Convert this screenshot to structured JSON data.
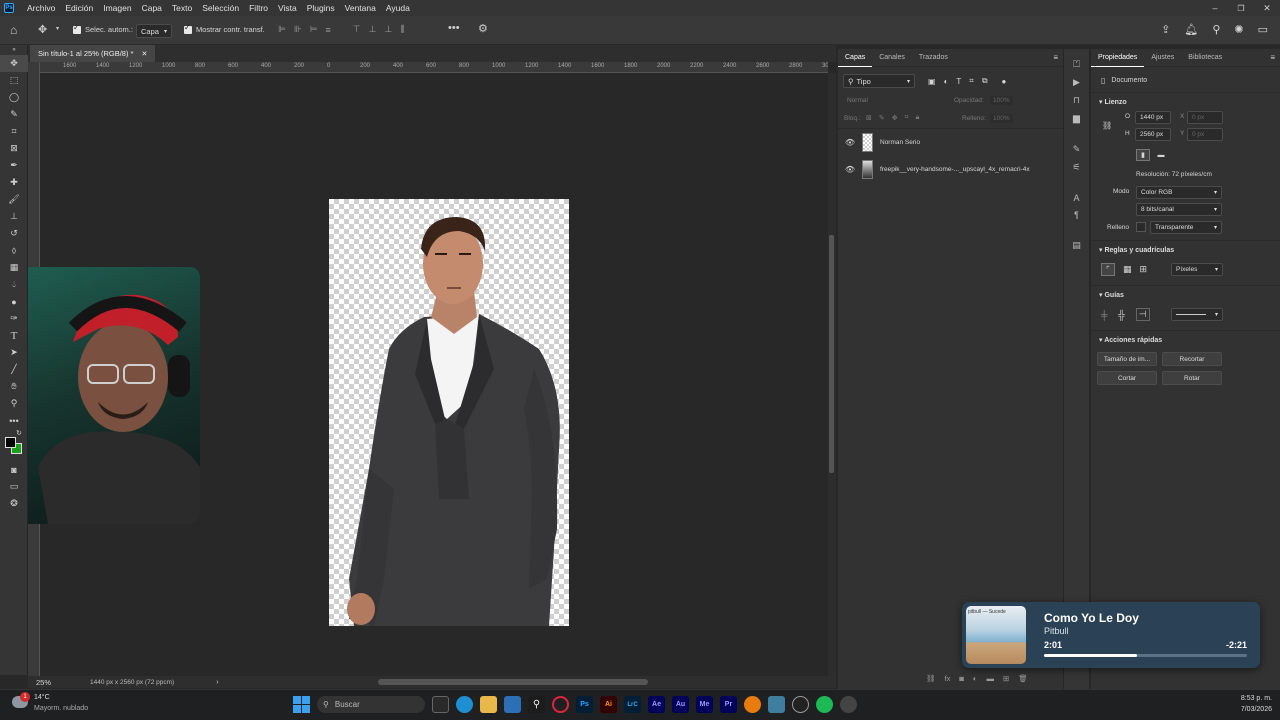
{
  "menu": [
    "Archivo",
    "Edición",
    "Imagen",
    "Capa",
    "Texto",
    "Selección",
    "Filtro",
    "Vista",
    "Plugins",
    "Ventana",
    "Ayuda"
  ],
  "options_bar": {
    "auto_select_label": "Selec. autom.:",
    "auto_select_value": "Capa",
    "show_transform_label": "Mostrar contr. transf."
  },
  "document": {
    "tab_title": "Sin título-1 al 25% (RGB/8) *",
    "zoom": "25%",
    "status": "1440 px x 2560 px (72 ppcm)"
  },
  "ruler_ticks": [
    "1600",
    "1400",
    "1200",
    "1000",
    "800",
    "600",
    "400",
    "200",
    "0",
    "200",
    "400",
    "600",
    "800",
    "1000",
    "1200",
    "1400",
    "1600",
    "1800",
    "2000",
    "2200",
    "2400",
    "2600",
    "2800",
    "3000"
  ],
  "layers_panel": {
    "tabs": [
      "Capas",
      "Canales",
      "Trazados"
    ],
    "active_tab": "Capas",
    "filter_label": "Tipo",
    "blend_mode": "Normal",
    "opacity_label": "Opacidad:",
    "opacity_value": "100%",
    "lock_label": "Bloq.:",
    "fill_label": "Relleno:",
    "fill_value": "100%",
    "layers": [
      {
        "name": "Norman Serio"
      },
      {
        "name": "freepik__very-handsome-..._upscayl_4x_remacri-4x"
      }
    ]
  },
  "properties_panel": {
    "tabs": [
      "Propiedades",
      "Ajustes",
      "Bibliotecas"
    ],
    "active_tab": "Propiedades",
    "doc_label": "Documento",
    "canvas": {
      "title": "Lienzo",
      "width_label": "O",
      "width": "1440 px",
      "height_label": "H",
      "height": "2560 px",
      "x_label": "X",
      "x_value": "0 px",
      "y_label": "Y",
      "y_value": "0 px",
      "resolution": "Resolución: 72 píxeles/cm",
      "mode_label": "Modo",
      "mode_value": "Color RGB",
      "depth_value": "8 bits/canal",
      "fill_label": "Relleno",
      "fill_value": "Transparente"
    },
    "rulers": {
      "title": "Reglas y cuadrículas",
      "unit": "Píxeles"
    },
    "guides": {
      "title": "Guías"
    },
    "quick_actions": {
      "title": "Acciones rápidas",
      "buttons": [
        "Tamaño de im...",
        "Recortar",
        "Cortar",
        "Rotar"
      ]
    }
  },
  "media": {
    "title": "Como Yo Le Doy",
    "artist": "Pitbull",
    "elapsed": "2:01",
    "remaining": "-2:21",
    "progress": 0.46,
    "album_text": "pitbull — Sucede"
  },
  "taskbar": {
    "weather_temp": "14°C",
    "weather_desc": "Mayorm. nublado",
    "notification_count": "1",
    "search_placeholder": "Buscar",
    "time": "8:53 p. m.",
    "date": "7/03/2026",
    "apps": [
      "Ps",
      "Ai",
      "LrC",
      "Ae",
      "Au",
      "Me",
      "Pr"
    ]
  },
  "colors": {
    "accent_ps": "#31a8ff",
    "media_bg": "#2b4256",
    "foreground": "#000000",
    "background": "#1aa31a"
  }
}
